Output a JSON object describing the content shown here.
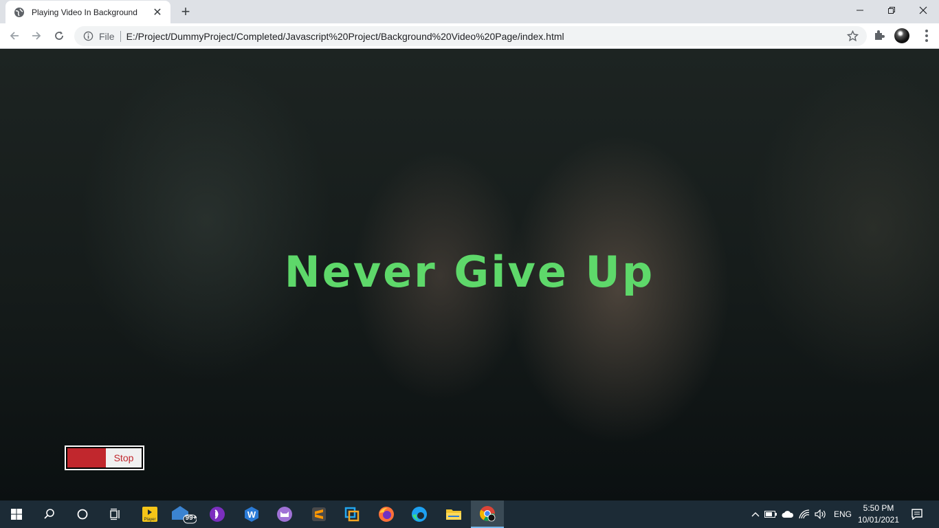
{
  "browser": {
    "tab_title": "Playing Video In Background",
    "scheme_label": "File",
    "url": "E:/Project/DummyProject/Completed/Javascript%20Project/Background%20Video%20Page/index.html"
  },
  "page": {
    "headline": "Never Give Up",
    "toggle_label": "Stop",
    "headline_color": "#5ed86a",
    "toggle_color": "#c1272d"
  },
  "taskbar": {
    "mail_badge": "99+",
    "player_label": "Player",
    "language": "ENG",
    "time": "5:50 PM",
    "date": "10/01/2021",
    "apps": [
      "start-icon",
      "search-icon",
      "cortana-icon",
      "task-view-icon",
      "player-icon",
      "mail-icon",
      "audio-app-icon",
      "wps-icon",
      "cat-app-icon",
      "sublime-icon",
      "vscode-icon",
      "firefox-icon",
      "edge-icon",
      "file-explorer-icon",
      "chrome-icon"
    ]
  }
}
